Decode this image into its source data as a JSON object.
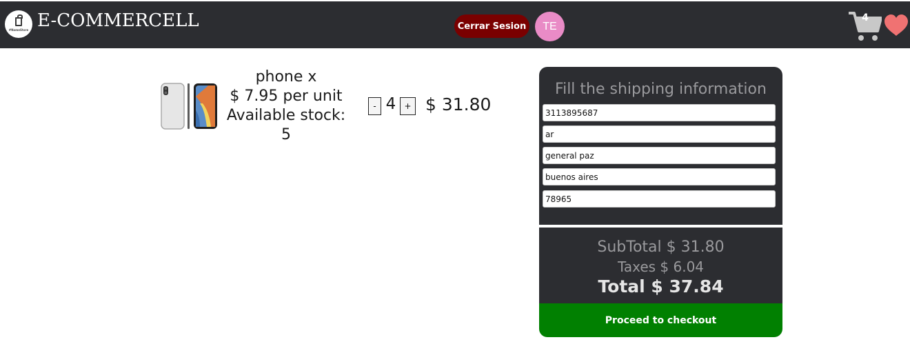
{
  "navbar": {
    "brand": "E-COMMERCELL",
    "logo_text": "#NameStore",
    "logout_label": "Cerrar Sesion",
    "user_initials": "TE",
    "cart_count": "4"
  },
  "product": {
    "name": "phone x",
    "price_per_unit": "$ 7.95 per unit",
    "stock_label": "Available stock:",
    "stock_value": "5",
    "qty_minus": "-",
    "quantity": "4",
    "qty_plus": "+",
    "line_total": "$ 31.80"
  },
  "shipping": {
    "title": "Fill the shipping information",
    "phone": "3113895687",
    "country": "ar",
    "street": "general paz",
    "city": "buenos aires",
    "zip": "78965"
  },
  "summary": {
    "subtotal": "SubTotal $ 31.80",
    "taxes": "Taxes $ 6.04",
    "total": "Total $ 37.84",
    "checkout_label": "Proceed to checkout"
  },
  "colors": {
    "navbar_bg": "#2c2d31",
    "logout_bg": "#7a0000",
    "avatar_bg": "#e98bc6",
    "heart": "#f07272",
    "cart": "#c8c8c8",
    "checkout_bg": "#018001"
  },
  "icons": [
    "store-logo-icon",
    "cart-icon",
    "heart-icon"
  ]
}
